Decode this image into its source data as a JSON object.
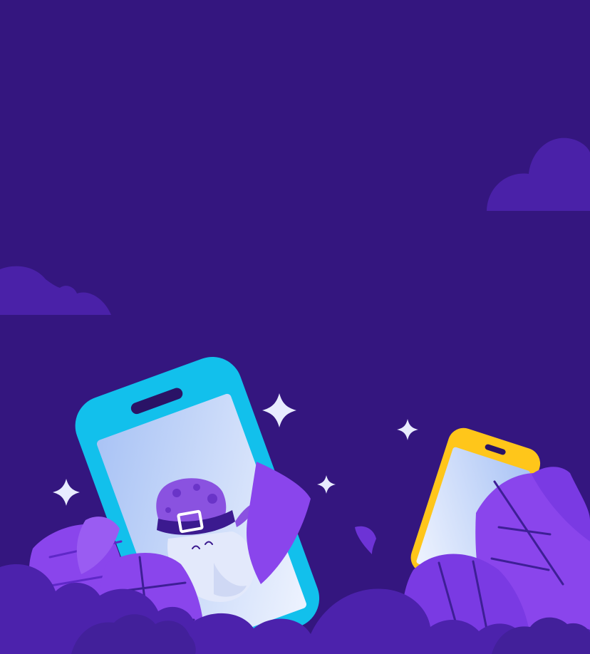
{
  "scene": {
    "description_icon": "phone-wizard-illustration",
    "colors": {
      "background": "#34167f",
      "cloud": "#4c22ac",
      "cloud_dark": "#42209a",
      "leaf_light": "#8f4bef",
      "leaf_mid": "#7a3ae3",
      "leaf_dark": "#5f28c8",
      "leaf_vein": "#3e1f96",
      "phone_cyan": "#1cc8ef",
      "phone_cyan_dark": "#0aa6d8",
      "phone_yellow": "#ffc61a",
      "phone_yellow_dark": "#f0a30a",
      "screen_light": "#e8f0fd",
      "screen_blue": "#a9c3f5",
      "notch": "#2a1366",
      "hat": "#8a52e0",
      "hat_spot": "#6a34c8",
      "hat_band": "#3b1a8f",
      "sparkle": "#e8ecff"
    }
  }
}
